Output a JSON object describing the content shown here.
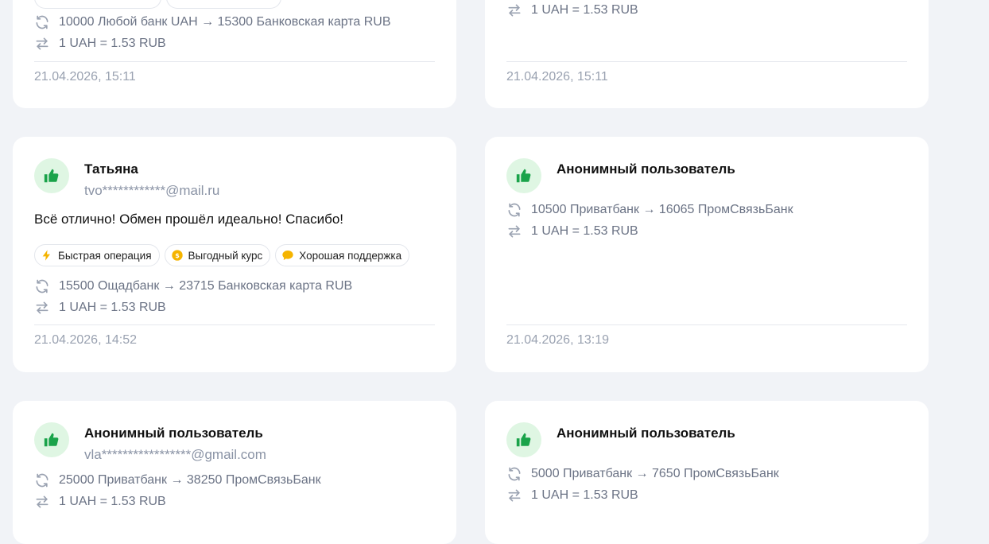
{
  "reviews": [
    {
      "exchange": "10000 Любой банк UAH → 15300 Банковская карта RUB",
      "rate": "1 UAH = 1.53 RUB",
      "date": "21.04.2026, 15:11"
    },
    {
      "rate": "1 UAH = 1.53 RUB",
      "date": "21.04.2026, 15:11"
    },
    {
      "name": "Татьяна",
      "email": "tvo************@mail.ru",
      "text": "Всё отлично! Обмен прошёл идеально! Спасибо!",
      "tags": [
        {
          "label": "Быстрая операция",
          "icon": "lightning-icon",
          "color": "#f5b400"
        },
        {
          "label": "Выгодный курс",
          "icon": "coin-icon",
          "color": "#f5b400"
        },
        {
          "label": "Хорошая поддержка",
          "icon": "chat-bubble-icon",
          "color": "#f5b400"
        }
      ],
      "exchange": "15500 Ощадбанк → 23715 Банковская карта RUB",
      "rate": "1 UAH = 1.53 RUB",
      "date": "21.04.2026, 14:52"
    },
    {
      "name": "Анонимный пользователь",
      "exchange": "10500 Приватбанк → 16065 ПромСвязьБанк",
      "rate": "1 UAH = 1.53 RUB",
      "date": "21.04.2026, 13:19"
    },
    {
      "name": "Анонимный пользователь",
      "email": "vla*****************@gmail.com",
      "exchange": "25000 Приватбанк → 38250 ПромСвязьБанк",
      "rate": "1 UAH = 1.53 RUB"
    },
    {
      "name": "Анонимный пользователь",
      "exchange": "5000 Приватбанк → 7650 ПромСвязьБанк",
      "rate": "1 UAH = 1.53 RUB"
    }
  ],
  "colors": {
    "accent_green": "#1aa34a",
    "avatar_bg": "#dff6e3",
    "muted_text": "#6b7385",
    "page_bg": "#f1f3f7"
  }
}
